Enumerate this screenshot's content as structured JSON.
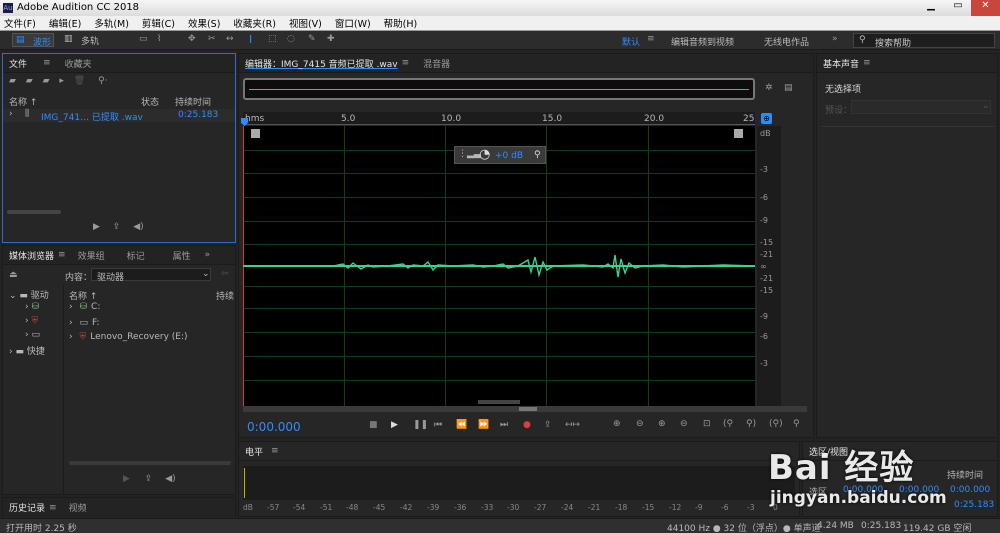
{
  "app": {
    "title": "Adobe Audition CC 2018"
  },
  "menu": [
    "文件(F)",
    "编辑(E)",
    "多轨(M)",
    "剪辑(C)",
    "效果(S)",
    "收藏夹(R)",
    "视图(V)",
    "窗口(W)",
    "帮助(H)"
  ],
  "toolbar": {
    "waveform_label": "波形",
    "multitrack_label": "多轨",
    "workspace_default": "默认",
    "workspace_edit_video": "编辑音频到视频",
    "workspace_radio": "无线电作品",
    "search_placeholder": "搜索帮助"
  },
  "files_panel": {
    "tab_files": "文件",
    "tab_favorites": "收藏夹",
    "col_name": "名称",
    "col_status": "状态",
    "col_duration": "持续时间",
    "file_name": "IMG_741… 已提取 .wav",
    "file_duration": "0:25.183"
  },
  "media_panel": {
    "tab_media": "媒体浏览器",
    "tab_effects": "效果组",
    "tab_markers": "标记",
    "tab_properties": "属性",
    "content_label": "内容：",
    "content_value": "驱动器",
    "col_name": "名称",
    "col_duration": "持续",
    "left_drives": "驱动",
    "left_shortcuts": "快捷",
    "drives": [
      "C:",
      "F:",
      "Lenovo_Recovery (E:)"
    ]
  },
  "history_panel": {
    "tab_history": "历史记录",
    "tab_video": "视频"
  },
  "editor": {
    "tab_editor": "编辑器：IMG_7415 音频已提取 .wav",
    "tab_mixer": "混音器",
    "ruler": [
      "hms",
      "5.0",
      "10.0",
      "15.0",
      "20.0",
      "25"
    ],
    "db_scale": [
      "dB",
      "-3",
      "-6",
      "-9",
      "-15",
      "-21",
      "∞",
      "-21",
      "-15",
      "-9",
      "-6",
      "-3"
    ],
    "volume": "+0 dB",
    "current_time": "0:00.000"
  },
  "level_panel": {
    "title": "电平",
    "scale": [
      "dB",
      "-57",
      "-54",
      "-51",
      "-48",
      "-45",
      "-42",
      "-39",
      "-36",
      "-33",
      "-30",
      "-27",
      "-24",
      "-21",
      "-18",
      "-15",
      "-12",
      "-9",
      "-6",
      "-3",
      "0"
    ]
  },
  "selection_panel": {
    "title": "选区/视图",
    "col_duration": "持续时间",
    "row_selection": "选区",
    "start": "0:00.000",
    "end": "0:00.000",
    "duration": "0:00.000",
    "duration_total": "0:25.183"
  },
  "essential_sound": {
    "title": "基本声音",
    "no_selection": "无选择项",
    "preset_label": "预设："
  },
  "status": {
    "left": "打开用时 2.25 秒",
    "format": "44100 Hz ● 32 位（浮点）● 单声道",
    "size": "4.24 MB",
    "duration": "0:25.183",
    "free": "119.42 GB 空闲"
  },
  "watermark": {
    "text": "Bai 经验",
    "url": "jingyan.baidu.com"
  }
}
